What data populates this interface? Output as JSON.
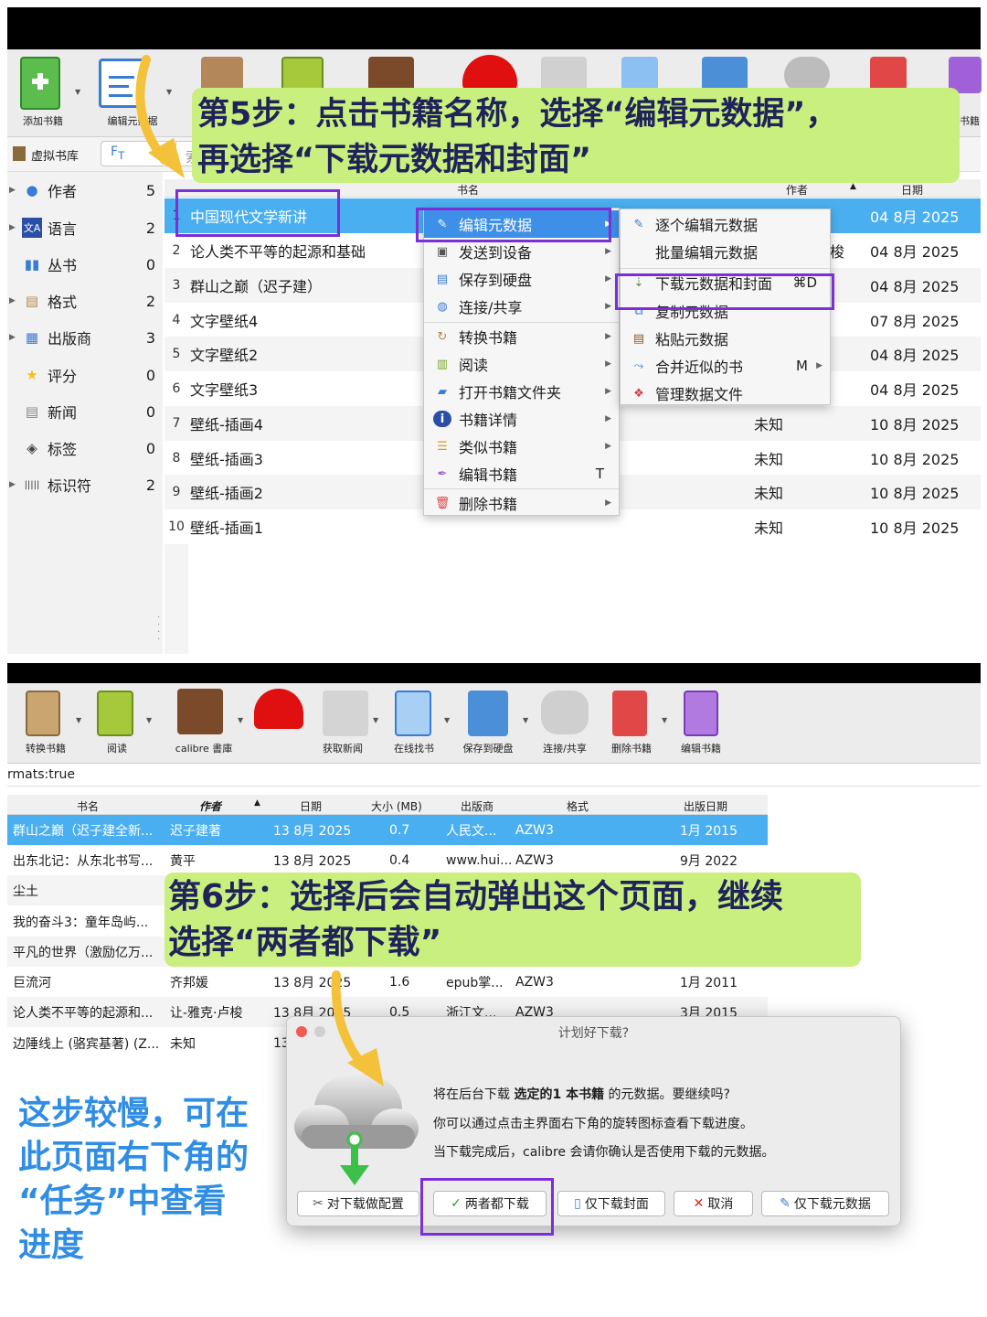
{
  "top": {
    "toolbar": {
      "add_book": "添加书籍",
      "edit_metadata": "编辑元数据",
      "right_cut_label": "书籍"
    },
    "virtual_library": "虚拟书库",
    "search_placeholder": "索",
    "sidebar": [
      {
        "label": "作者",
        "count": "5"
      },
      {
        "label": "语言",
        "count": "2"
      },
      {
        "label": "丛书",
        "count": "0"
      },
      {
        "label": "格式",
        "count": "2"
      },
      {
        "label": "出版商",
        "count": "3"
      },
      {
        "label": "评分",
        "count": "0"
      },
      {
        "label": "新闻",
        "count": "0"
      },
      {
        "label": "标签",
        "count": "0"
      },
      {
        "label": "标识符",
        "count": "2"
      }
    ],
    "columns": {
      "title": "书名",
      "author": "作者",
      "date": "日期"
    },
    "rows": [
      {
        "num": "1",
        "title": "中国现代文学新讲",
        "author": "",
        "date": "04 8月 2025"
      },
      {
        "num": "2",
        "title": "论人类不平等的起源和基础",
        "author": "梭",
        "date": "04 8月 2025"
      },
      {
        "num": "3",
        "title": "群山之巅（迟子建）",
        "author": "",
        "date": "04 8月 2025"
      },
      {
        "num": "4",
        "title": "文字壁纸4",
        "author": "",
        "date": "07 8月 2025"
      },
      {
        "num": "5",
        "title": "文字壁纸2",
        "author": "",
        "date": "04 8月 2025"
      },
      {
        "num": "6",
        "title": "文字壁纸3",
        "author": "",
        "date": "04 8月 2025"
      },
      {
        "num": "7",
        "title": "壁纸-插画4",
        "author": "未知",
        "date": "10 8月 2025"
      },
      {
        "num": "8",
        "title": "壁纸-插画3",
        "author": "未知",
        "date": "10 8月 2025"
      },
      {
        "num": "9",
        "title": "壁纸-插画2",
        "author": "未知",
        "date": "10 8月 2025"
      },
      {
        "num": "10",
        "title": "壁纸-插画1",
        "author": "未知",
        "date": "10 8月 2025"
      }
    ],
    "context_menu": [
      {
        "label": "编辑元数据",
        "sub": true
      },
      {
        "label": "发送到设备",
        "sub": true
      },
      {
        "label": "保存到硬盘",
        "sub": true
      },
      {
        "label": "连接/共享",
        "sub": true
      },
      {
        "label": "转换书籍",
        "sub": true
      },
      {
        "label": "阅读",
        "sub": true
      },
      {
        "label": "打开书籍文件夹",
        "sub": true
      },
      {
        "label": "书籍详情",
        "sub": true
      },
      {
        "label": "类似书籍",
        "sub": true
      },
      {
        "label": "编辑书籍",
        "shortcut": "T"
      },
      {
        "label": "删除书籍",
        "sub": true
      }
    ],
    "submenu": [
      {
        "label": "逐个编辑元数据"
      },
      {
        "label": "批量编辑元数据"
      },
      {
        "label": "下载元数据和封面",
        "shortcut": "⌘D"
      },
      {
        "label": "复制元数据"
      },
      {
        "label": "粘贴元数据"
      },
      {
        "label": "合并近似的书",
        "shortcut": "M"
      },
      {
        "label": "管理数据文件"
      }
    ],
    "callout_line1": "第5步：点击书籍名称，选择“编辑元数据”，",
    "callout_line2": "再选择“下载元数据和封面”"
  },
  "bottom": {
    "toolbar": [
      {
        "label": "转换书籍"
      },
      {
        "label": "阅读"
      },
      {
        "label": "calibre 書庫"
      },
      {
        "label": ""
      },
      {
        "label": "获取新闻"
      },
      {
        "label": "在线找书"
      },
      {
        "label": "保存到硬盘"
      },
      {
        "label": "连接/共享"
      },
      {
        "label": "删除书籍"
      },
      {
        "label": "编辑书籍"
      }
    ],
    "search_text": "rmats:true",
    "columns": {
      "title": "书名",
      "author": "作者",
      "date": "日期",
      "size": "大小 (MB)",
      "publisher": "出版商",
      "format": "格式",
      "pubdate": "出版日期"
    },
    "rows": [
      {
        "title": "群山之巅（迟子建全新...",
        "author": "迟子建著",
        "date": "13 8月 2025",
        "size": "0.7",
        "publisher": "人民文...",
        "format": "AZW3",
        "pubdate": "1月 2015"
      },
      {
        "title": "出东北记：从东北书写...",
        "author": "黄平",
        "date": "13 8月 2025",
        "size": "0.4",
        "publisher": "www.hui...",
        "format": "AZW3",
        "pubdate": "9月 2022"
      },
      {
        "title": "尘土",
        "author": "",
        "date": "",
        "size": "",
        "publisher": "",
        "format": "",
        "pubdate": ""
      },
      {
        "title": "我的奋斗3：童年岛屿...",
        "author": "",
        "date": "",
        "size": "",
        "publisher": "",
        "format": "",
        "pubdate": ""
      },
      {
        "title": "平凡的世界（激励亿万...",
        "author": "",
        "date": "",
        "size": "",
        "publisher": "",
        "format": "",
        "pubdate": ""
      },
      {
        "title": "巨流河",
        "author": "齐邦媛",
        "date": "13 8月 2025",
        "size": "1.6",
        "publisher": "epub掌...",
        "format": "AZW3",
        "pubdate": "1月 2011"
      },
      {
        "title": "论人类不平等的起源和...",
        "author": "让-雅克·卢梭",
        "date": "13 8月 2025",
        "size": "0.5",
        "publisher": "浙江文...",
        "format": "AZW3",
        "pubdate": "3月 2015"
      },
      {
        "title": "边陲线上 (骆宾基著) (Z...",
        "author": "未知",
        "date": "13",
        "size": "",
        "publisher": "",
        "format": "",
        "pubdate": ""
      }
    ],
    "callout_line1": "第6步：选择后会自动弹出这个页面，继续",
    "callout_line2": "选择“两者都下载”",
    "dialog": {
      "title": "计划好下载?",
      "msg1_pre": "将在后台下载 ",
      "msg1_bold": "选定的1 本书籍",
      "msg1_post": " 的元数据。要继续吗?",
      "msg2": "你可以通过点击主界面右下角的旋转图标查看下载进度。",
      "msg3": "当下载完成后，calibre 会请你确认是否使用下载的元数据。",
      "btn_config": "对下载做配置",
      "btn_both": "两者都下载",
      "btn_cover": "仅下载封面",
      "btn_cancel": "取消",
      "btn_meta": "仅下载元数据"
    },
    "note": [
      "这步较慢，可在",
      "此页面右下角的",
      "“任务”中查看",
      "进度"
    ]
  }
}
